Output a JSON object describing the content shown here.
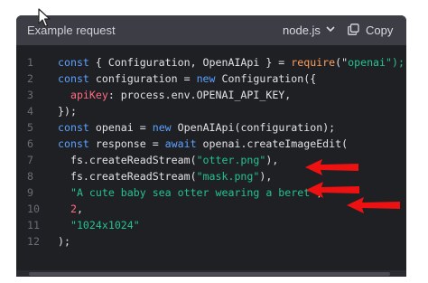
{
  "header": {
    "title": "Example request",
    "language": "node.js",
    "copy_label": "Copy"
  },
  "code_lines": [
    {
      "num": "1",
      "tokens": [
        {
          "t": "const",
          "c": "kw"
        },
        {
          "t": " { Configuration, OpenAIApi } = ",
          "c": "fn"
        },
        {
          "t": "require",
          "c": "req"
        },
        {
          "t": "(\"",
          "c": "fn"
        },
        {
          "t": "openai\");",
          "c": "str"
        }
      ]
    },
    {
      "num": "2",
      "tokens": [
        {
          "t": "const",
          "c": "kw"
        },
        {
          "t": " configuration = ",
          "c": "fn"
        },
        {
          "t": "new",
          "c": "kw"
        },
        {
          "t": " Configuration({",
          "c": "fn"
        }
      ]
    },
    {
      "num": "3",
      "tokens": [
        {
          "t": "  apiKey",
          "c": "prop"
        },
        {
          "t": ": process.env.OPENAI_API_KEY,",
          "c": "fn"
        }
      ]
    },
    {
      "num": "4",
      "tokens": [
        {
          "t": "});",
          "c": "fn"
        }
      ]
    },
    {
      "num": "5",
      "tokens": [
        {
          "t": "const",
          "c": "kw"
        },
        {
          "t": " openai = ",
          "c": "fn"
        },
        {
          "t": "new",
          "c": "kw"
        },
        {
          "t": " OpenAIApi(configuration);",
          "c": "fn"
        }
      ]
    },
    {
      "num": "6",
      "tokens": [
        {
          "t": "const",
          "c": "kw"
        },
        {
          "t": " response = ",
          "c": "fn"
        },
        {
          "t": "await",
          "c": "kw"
        },
        {
          "t": " openai.createImageEdit(",
          "c": "fn"
        }
      ]
    },
    {
      "num": "7",
      "tokens": [
        {
          "t": "  fs.createReadStream(",
          "c": "fn"
        },
        {
          "t": "\"otter.png\"",
          "c": "str"
        },
        {
          "t": "),",
          "c": "fn"
        }
      ]
    },
    {
      "num": "8",
      "tokens": [
        {
          "t": "  fs.createReadStream(",
          "c": "fn"
        },
        {
          "t": "\"mask.png\"",
          "c": "str"
        },
        {
          "t": "),",
          "c": "fn"
        }
      ]
    },
    {
      "num": "9",
      "tokens": [
        {
          "t": "  \"A cute baby sea otter wearing a beret\"",
          "c": "str"
        },
        {
          "t": ",",
          "c": "fn"
        }
      ]
    },
    {
      "num": "10",
      "tokens": [
        {
          "t": "  2",
          "c": "num"
        },
        {
          "t": ",",
          "c": "fn"
        }
      ]
    },
    {
      "num": "11",
      "tokens": [
        {
          "t": "  \"1024x1024\"",
          "c": "str"
        }
      ]
    },
    {
      "num": "12",
      "tokens": [
        {
          "t": ");",
          "c": "fn"
        }
      ]
    }
  ],
  "colors": {
    "panel_bg": "#1f2024",
    "header_bg": "#3d3e45",
    "keyword": "#5aa1ff",
    "string": "#23c28f",
    "require": "#ff9e5a",
    "property": "#ff6b81",
    "annotation_arrow": "#ee1111"
  },
  "icons": {
    "chevron": "chevron-down-icon",
    "copy": "copy-icon",
    "cursor": "mouse-cursor-icon",
    "arrow": "red-arrow-annotation"
  }
}
